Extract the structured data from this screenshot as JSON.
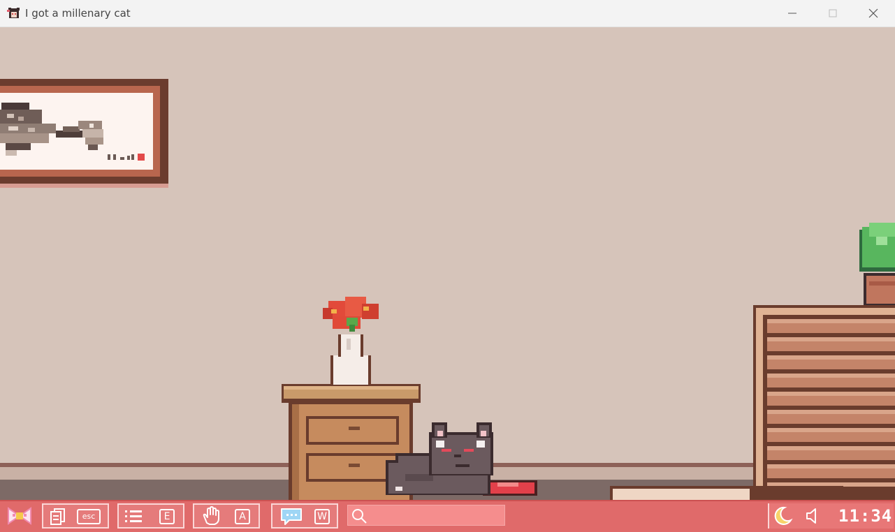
{
  "window": {
    "title": "I got a millenary cat",
    "controls": [
      "minimize",
      "maximize",
      "close"
    ]
  },
  "scene": {
    "objects": [
      "wall-painting",
      "flower-vase",
      "nightstand",
      "sleeping-cat",
      "food-bowl",
      "bookshelf",
      "potted-plant"
    ]
  },
  "toolbar": {
    "menu_icon": "bow-icon",
    "buttons": [
      {
        "icon": "notes-icon",
        "key": "esc"
      },
      {
        "icon": "list-icon",
        "key": "E"
      },
      {
        "icon": "hand-icon",
        "key": "A"
      },
      {
        "icon": "chat-icon",
        "key": "W"
      }
    ],
    "search": {
      "icon": "search-icon",
      "placeholder": "",
      "value": ""
    },
    "night_icon": "moon-icon",
    "sound_icon": "speaker-icon",
    "clock": "11:34"
  },
  "colors": {
    "wall": "#d6c4ba",
    "toolbar": "#e06a6a",
    "wood": "#c68b5e",
    "cat": "#6b5a5e"
  }
}
